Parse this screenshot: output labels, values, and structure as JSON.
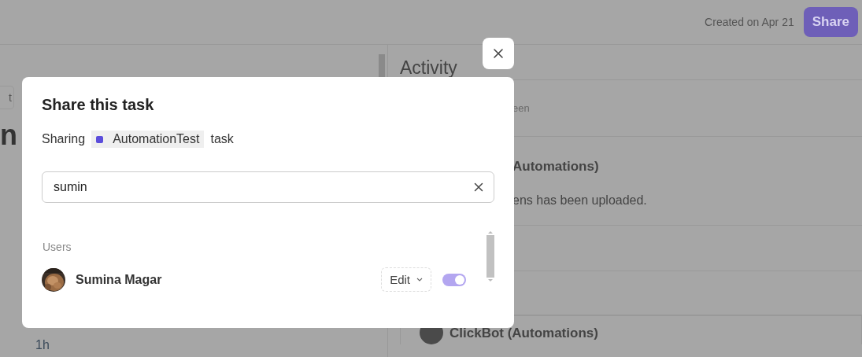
{
  "header": {
    "created": "Created on Apr 21",
    "share_button": "Share"
  },
  "left_panel": {
    "tag": "t",
    "title": "n",
    "duration": "1h"
  },
  "activity": {
    "title": "Activity",
    "entries": [
      {
        "kind": "meta",
        "text": "een"
      },
      {
        "kind": "event",
        "author": "Automations)",
        "message": "ens has been uploaded."
      },
      {
        "kind": "blank"
      },
      {
        "kind": "blank"
      }
    ],
    "last_entry": {
      "author": "ClickBot (Automations)"
    }
  },
  "dialog": {
    "title": "Share this task",
    "sharing": {
      "prefix": "Sharing",
      "task_name": "AutomationTest",
      "suffix": "task"
    },
    "search": {
      "value": "sumin"
    },
    "section": "Users",
    "users": [
      {
        "name": "Sumina Magar",
        "permission": "Edit",
        "on": true
      }
    ]
  }
}
